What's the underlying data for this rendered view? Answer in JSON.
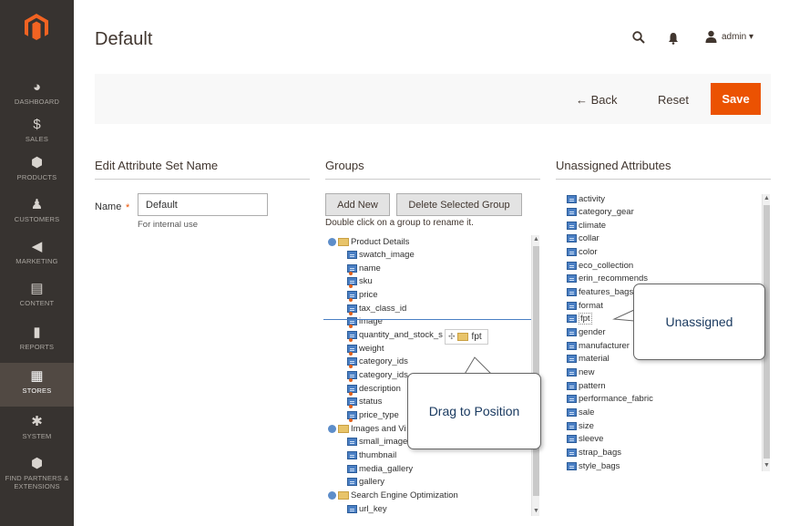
{
  "sidebar": {
    "items": [
      {
        "label": "DASHBOARD",
        "icon": "dashboard-icon",
        "glyph": "◕"
      },
      {
        "label": "SALES",
        "icon": "dollar-icon",
        "glyph": "$"
      },
      {
        "label": "PRODUCTS",
        "icon": "cube-icon",
        "glyph": "⬢"
      },
      {
        "label": "CUSTOMERS",
        "icon": "person-icon",
        "glyph": "♟"
      },
      {
        "label": "MARKETING",
        "icon": "megaphone-icon",
        "glyph": "◀"
      },
      {
        "label": "CONTENT",
        "icon": "layout-icon",
        "glyph": "▤"
      },
      {
        "label": "REPORTS",
        "icon": "bar-chart-icon",
        "glyph": "▮"
      },
      {
        "label": "STORES",
        "icon": "store-icon",
        "glyph": "▦"
      },
      {
        "label": "SYSTEM",
        "icon": "gear-icon",
        "glyph": "✱"
      },
      {
        "label": "FIND PARTNERS & EXTENSIONS",
        "icon": "partners-icon",
        "glyph": "⬢"
      }
    ],
    "active": "STORES"
  },
  "header": {
    "title": "Default",
    "user": "admin ▾"
  },
  "actions": {
    "back": "← Back",
    "reset": "Reset",
    "save": "Save"
  },
  "edit_name": {
    "heading": "Edit Attribute Set Name",
    "label": "Name",
    "required": "*",
    "value": "Default",
    "note": "For internal use"
  },
  "groups": {
    "heading": "Groups",
    "add_new": "Add New",
    "delete_group": "Delete Selected Group",
    "hint": "Double click on a group to rename it.",
    "tree": [
      {
        "type": "group",
        "label": "Product Details"
      },
      {
        "type": "attr",
        "label": "swatch_image"
      },
      {
        "type": "attr",
        "label": "name",
        "sys": true
      },
      {
        "type": "attr",
        "label": "sku",
        "sys": true
      },
      {
        "type": "attr",
        "label": "price",
        "sys": true
      },
      {
        "type": "attr",
        "label": "tax_class_id",
        "sys": true
      },
      {
        "type": "attr",
        "label": "image",
        "sys": true
      },
      {
        "type": "attr",
        "label": "quantity_and_stock_s",
        "sys": true
      },
      {
        "type": "attr",
        "label": "weight",
        "sys": true
      },
      {
        "type": "attr",
        "label": "category_ids",
        "sys": true
      },
      {
        "type": "attr",
        "label": "category_ids",
        "sys": true
      },
      {
        "type": "attr",
        "label": "description",
        "sys": true
      },
      {
        "type": "attr",
        "label": "status",
        "sys": true
      },
      {
        "type": "attr",
        "label": "price_type",
        "sys": true
      },
      {
        "type": "group",
        "label": "Images and Vi"
      },
      {
        "type": "attr",
        "label": "small_image"
      },
      {
        "type": "attr",
        "label": "thumbnail"
      },
      {
        "type": "attr",
        "label": "media_gallery"
      },
      {
        "type": "attr",
        "label": "gallery"
      },
      {
        "type": "group",
        "label": "Search Engine Optimization"
      },
      {
        "type": "attr",
        "label": "url_key"
      }
    ],
    "drag_item": "fpt"
  },
  "unassigned": {
    "heading": "Unassigned Attributes",
    "items": [
      "activity",
      "category_gear",
      "climate",
      "collar",
      "color",
      "eco_collection",
      "erin_recommends",
      "features_bags",
      "format",
      "fpt",
      "gender",
      "manufacturer",
      "material",
      "new",
      "pattern",
      "performance_fabric",
      "sale",
      "size",
      "sleeve",
      "strap_bags",
      "style_bags"
    ]
  },
  "callouts": {
    "unassigned": "Unassigned",
    "drag": "Drag to Position"
  },
  "colors": {
    "sidebar": "#373330",
    "accent": "#eb5202"
  }
}
